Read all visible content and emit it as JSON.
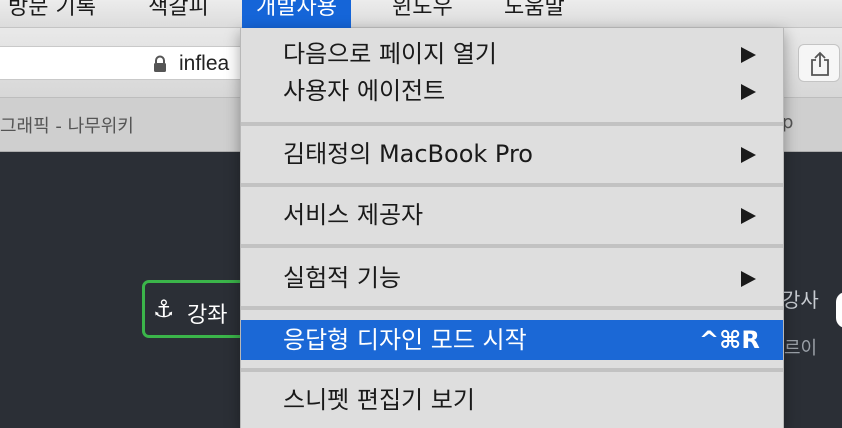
{
  "menubar": {
    "items": [
      {
        "label": "방문 기록"
      },
      {
        "label": "책갈피"
      },
      {
        "label": "개발자용"
      },
      {
        "label": "윈도우"
      },
      {
        "label": "도움말"
      }
    ],
    "active_index": 2
  },
  "toolbar": {
    "url_text": "inflea",
    "share_icon": "share-icon",
    "lock_icon": "lock-icon"
  },
  "tabbar": {
    "left_tab_title": "그래픽 - 나무위키",
    "right_tab_title": "p"
  },
  "page": {
    "button_label": "강좌",
    "button_icon": "anchor-icon",
    "side_text_1": "강사",
    "side_text_2": "르이"
  },
  "menu": {
    "items": [
      {
        "label": "다음으로 페이지 열기",
        "has_submenu": true
      },
      {
        "label": "사용자 에이전트",
        "has_submenu": true
      },
      {
        "label": "김태정의 MacBook Pro",
        "has_submenu": true
      },
      {
        "label": "서비스 제공자",
        "has_submenu": true
      },
      {
        "label": "실험적 기능",
        "has_submenu": true
      },
      {
        "label": "응답형 디자인 모드 시작",
        "shortcut": "^⌘R",
        "highlighted": true
      },
      {
        "label": "스니펫 편집기 보기"
      }
    ]
  },
  "colors": {
    "highlight": "#1b68d6",
    "menubar_active": "#1565d8",
    "page_bg": "#2b2f36",
    "button_border": "#3bb54a"
  }
}
